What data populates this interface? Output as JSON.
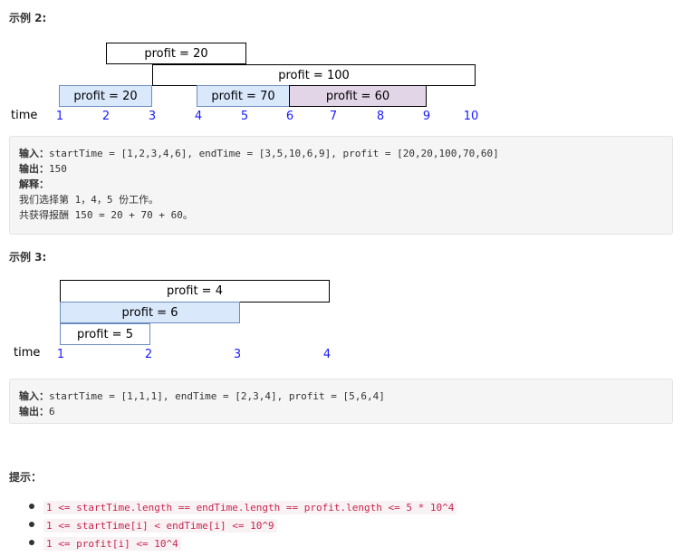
{
  "example2": {
    "heading": "示例 2:",
    "time_label": "time",
    "ticks": [
      "1",
      "2",
      "3",
      "4",
      "5",
      "6",
      "7",
      "8",
      "9",
      "10"
    ],
    "jobs": [
      {
        "label": "profit = 20",
        "style": "white"
      },
      {
        "label": "profit = 100",
        "style": "white"
      },
      {
        "label": "profit = 20",
        "style": "blue"
      },
      {
        "label": "profit = 70",
        "style": "blue"
      },
      {
        "label": "profit = 60",
        "style": "purple"
      }
    ],
    "input_key": "输入：",
    "input_val": "startTime = [1,2,3,4,6], endTime = [3,5,10,6,9], profit = [20,20,100,70,60]",
    "output_key": "输出：",
    "output_val": "150",
    "explain_key": "解释：",
    "explain_line1": "我们选择第 1，4，5 份工作。",
    "explain_line2": "共获得报酬 150 = 20 + 70 + 60。"
  },
  "example3": {
    "heading": "示例 3:",
    "time_label": "time",
    "ticks": [
      "1",
      "2",
      "3",
      "4"
    ],
    "jobs": [
      {
        "label": "profit = 4",
        "style": "white"
      },
      {
        "label": "profit = 6",
        "style": "blue"
      },
      {
        "label": "profit = 5",
        "style": "white"
      }
    ],
    "input_key": "输入：",
    "input_val": "startTime = [1,1,1], endTime = [2,3,4], profit = [5,6,4]",
    "output_key": "输出：",
    "output_val": "6"
  },
  "hints": {
    "heading": "提示：",
    "items": [
      "1 <= startTime.length == endTime.length == profit.length <= 5 * 10^4",
      "1 <= startTime[i] < endTime[i] <= 10^9",
      "1 <= profit[i] <= 10^4"
    ]
  }
}
